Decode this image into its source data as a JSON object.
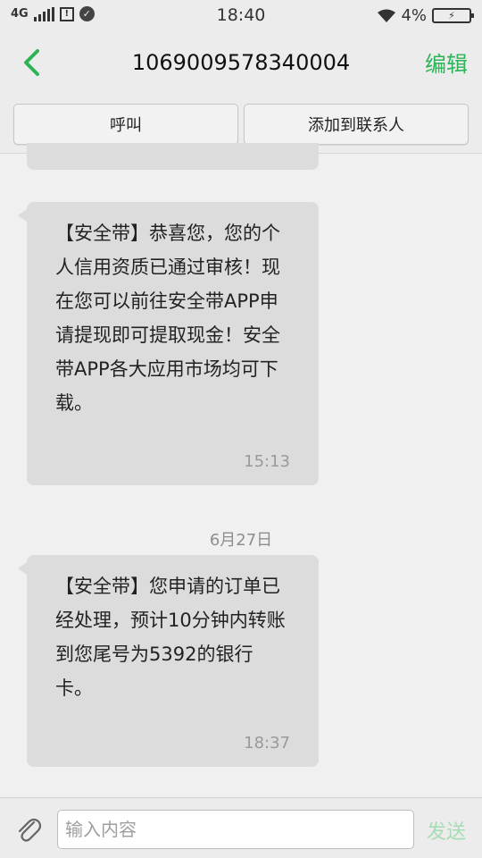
{
  "status_bar": {
    "network": "4G",
    "time": "18:40",
    "battery_percent": "4%",
    "battery_level": 0.04,
    "icons": [
      "signal-icon",
      "sim-icon",
      "check-circle-icon",
      "wifi-icon",
      "battery-icon"
    ]
  },
  "header": {
    "title": "1069009578340004",
    "edit_label": "编辑",
    "accent_color": "#2db457"
  },
  "actions": {
    "call_label": "呼叫",
    "add_contact_label": "添加到联系人"
  },
  "messages": [
    {
      "text": "【安全带】恭喜您，您的个人信用资质已通过审核！现在您可以前往安全带APP申请提现即可提取现金！安全带APP各大应用市场均可下载。",
      "time": "15:13"
    },
    {
      "date_separator": "6月27日",
      "text": "【安全带】您申请的订单已经处理，预计10分钟内转账到您尾号为5392的银行卡。",
      "time": "18:37"
    }
  ],
  "input_bar": {
    "placeholder": "输入内容",
    "send_label": "发送",
    "send_color": "#a6dcb4"
  }
}
